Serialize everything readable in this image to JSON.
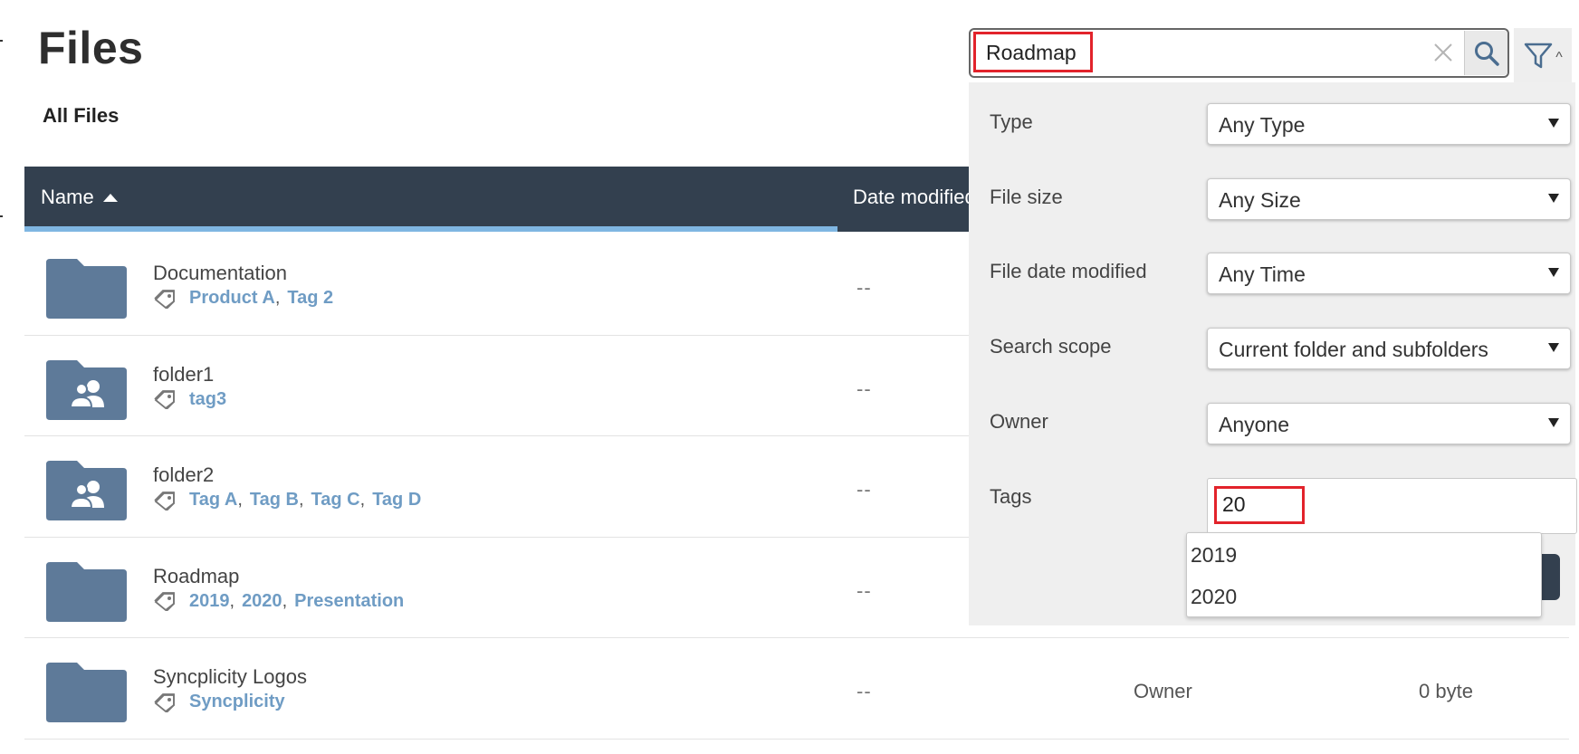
{
  "page": {
    "title": "Files",
    "breadcrumb": "All Files"
  },
  "table": {
    "columns": {
      "name": "Name",
      "date_modified": "Date modified"
    },
    "rows": [
      {
        "name": "Documentation",
        "icon": "folder-icon",
        "tags": [
          "Product A",
          "Tag 2"
        ],
        "date": "--",
        "owner": "",
        "size": ""
      },
      {
        "name": "folder1",
        "icon": "shared-folder-icon",
        "tags": [
          "tag3"
        ],
        "date": "--",
        "owner": "",
        "size": ""
      },
      {
        "name": "folder2",
        "icon": "shared-folder-icon",
        "tags": [
          "Tag A",
          "Tag B",
          "Tag C",
          "Tag D"
        ],
        "date": "--",
        "owner": "",
        "size": ""
      },
      {
        "name": "Roadmap",
        "icon": "folder-icon",
        "tags": [
          "2019",
          "2020",
          "Presentation"
        ],
        "date": "--",
        "owner": "",
        "size": ""
      },
      {
        "name": "Syncplicity Logos",
        "icon": "folder-icon",
        "tags": [
          "Syncplicity"
        ],
        "date": "--",
        "owner": "Owner",
        "size": "0 byte"
      }
    ]
  },
  "search": {
    "value": "Roadmap",
    "clear_icon": "close-icon",
    "search_icon": "search-icon",
    "filter_icon": "filter-icon",
    "filter_caret": "^"
  },
  "filters": {
    "type": {
      "label": "Type",
      "value": "Any Type"
    },
    "file_size": {
      "label": "File size",
      "value": "Any Size"
    },
    "date_modified": {
      "label": "File date modified",
      "value": "Any Time"
    },
    "scope": {
      "label": "Search scope",
      "value": "Current folder and subfolders"
    },
    "owner": {
      "label": "Owner",
      "value": "Anyone"
    },
    "tags": {
      "label": "Tags",
      "value": "20",
      "suggestions": [
        "2019",
        "2020"
      ]
    }
  },
  "colors": {
    "header_bg": "#33404f",
    "sort_underline": "#7fb6e2",
    "tag_link": "#6f9cc4",
    "folder": "#5e7a99",
    "highlight": "#e2232b",
    "panel_bg": "#efefef"
  }
}
